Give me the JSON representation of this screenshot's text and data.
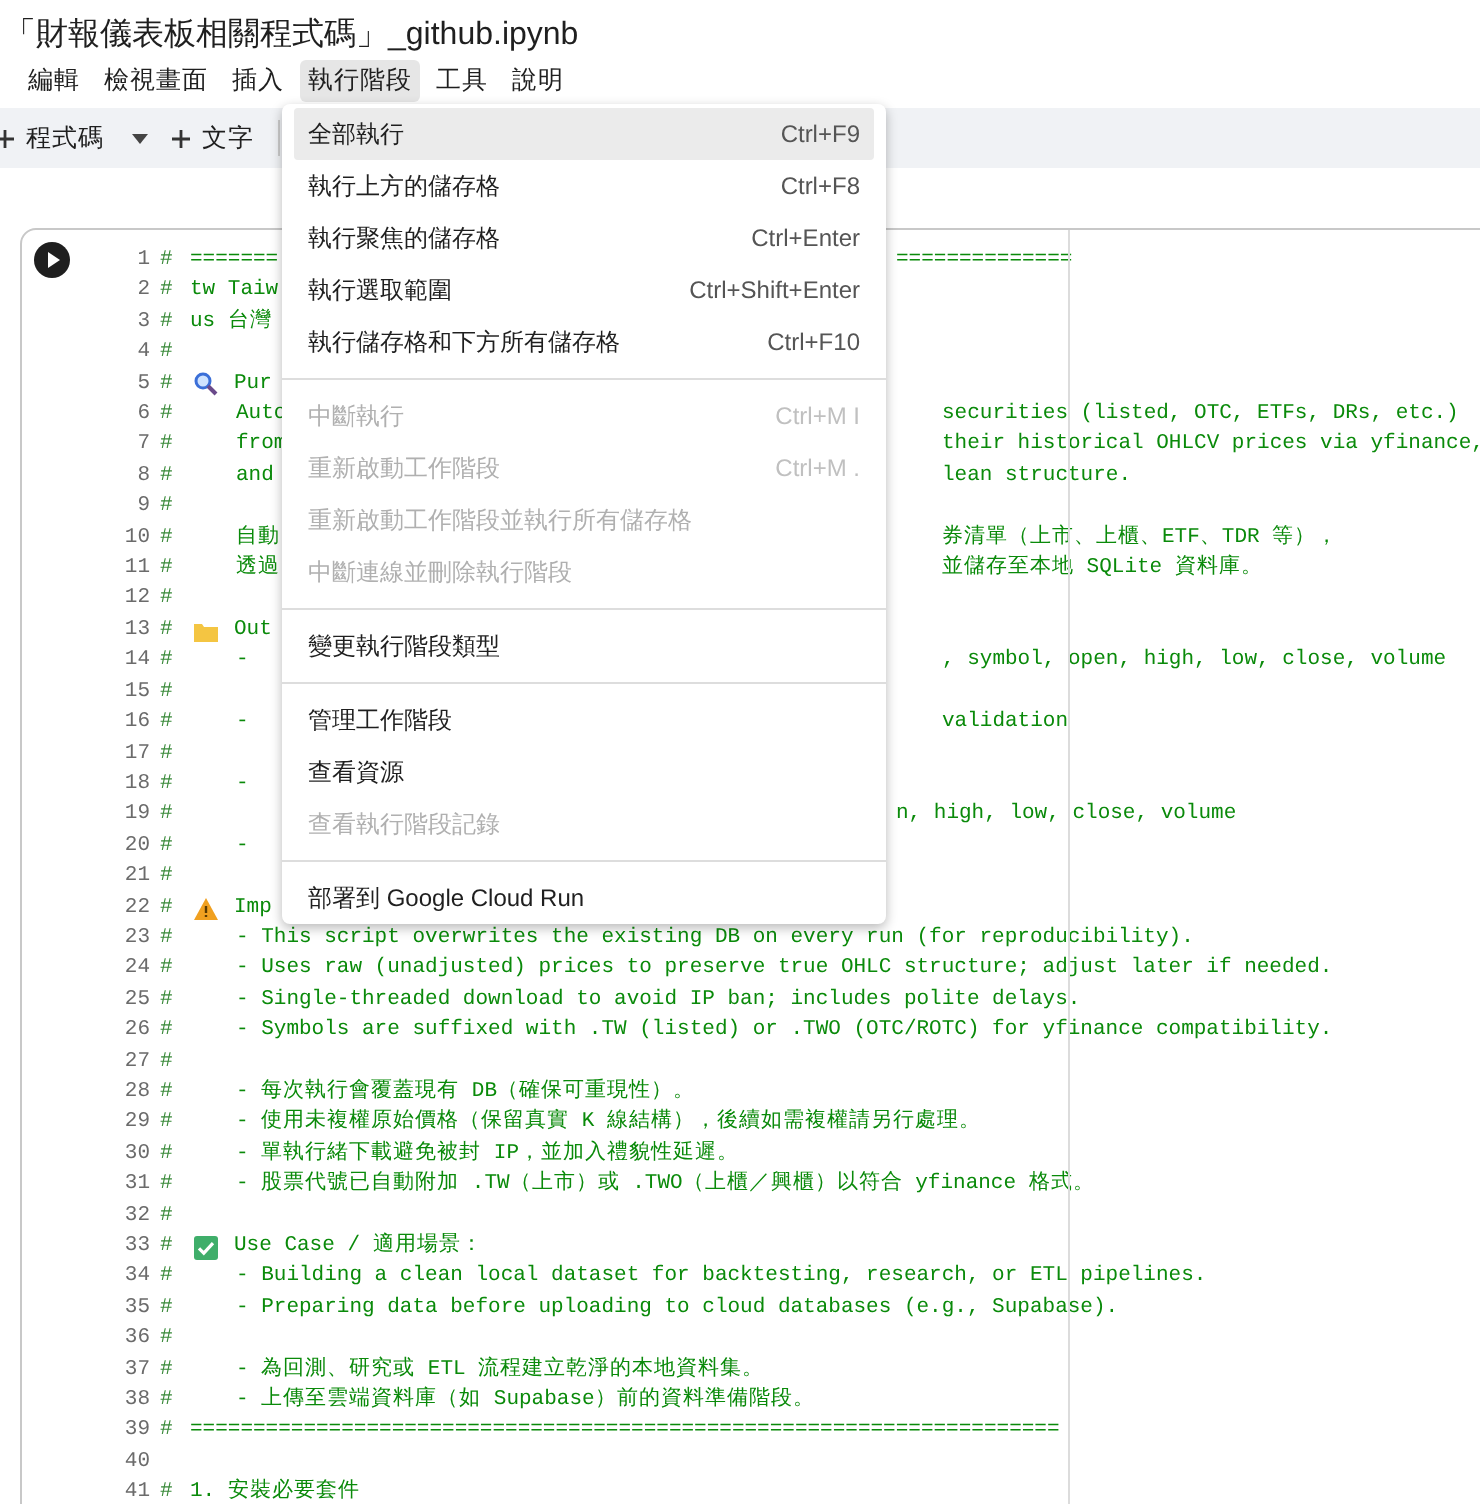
{
  "notebook": {
    "title": "「財報儀表板相關程式碼」_github.ipynb"
  },
  "menubar": [
    {
      "label": "編輯",
      "selected": false
    },
    {
      "label": "檢視畫面",
      "selected": false
    },
    {
      "label": "插入",
      "selected": false
    },
    {
      "label": "執行階段",
      "selected": true
    },
    {
      "label": "工具",
      "selected": false
    },
    {
      "label": "說明",
      "selected": false
    }
  ],
  "toolbar": {
    "code_button": "程式碼",
    "text_button": "文字"
  },
  "runtime_menu": [
    [
      {
        "label": "全部執行",
        "shortcut": "Ctrl+F9",
        "disabled": false,
        "selected": true
      },
      {
        "label": "執行上方的儲存格",
        "shortcut": "Ctrl+F8",
        "disabled": false,
        "selected": false
      },
      {
        "label": "執行聚焦的儲存格",
        "shortcut": "Ctrl+Enter",
        "disabled": false,
        "selected": false
      },
      {
        "label": "執行選取範圍",
        "shortcut": "Ctrl+Shift+Enter",
        "disabled": false,
        "selected": false
      },
      {
        "label": "執行儲存格和下方所有儲存格",
        "shortcut": "Ctrl+F10",
        "disabled": false,
        "selected": false
      }
    ],
    [
      {
        "label": "中斷執行",
        "shortcut": "Ctrl+M I",
        "disabled": true,
        "selected": false
      },
      {
        "label": "重新啟動工作階段",
        "shortcut": "Ctrl+M .",
        "disabled": true,
        "selected": false
      },
      {
        "label": "重新啟動工作階段並執行所有儲存格",
        "disabled": true,
        "selected": false
      },
      {
        "label": "中斷連線並刪除執行階段",
        "disabled": true,
        "selected": false
      }
    ],
    [
      {
        "label": "變更執行階段類型",
        "disabled": false,
        "selected": false
      }
    ],
    [
      {
        "label": "管理工作階段",
        "disabled": false,
        "selected": false
      },
      {
        "label": "查看資源",
        "disabled": false,
        "selected": false
      },
      {
        "label": "查看執行階段記錄",
        "disabled": true,
        "selected": false
      }
    ],
    [
      {
        "label": "部署到 Google Cloud Run",
        "disabled": false,
        "selected": false
      }
    ]
  ],
  "code_lines": [
    {
      "n": "1",
      "hash": "#",
      "indented": false,
      "text": "=======",
      "right": "=============="
    },
    {
      "n": "2",
      "hash": "#",
      "indented": false,
      "text": "tw Taiw"
    },
    {
      "n": "3",
      "hash": "#",
      "indented": false,
      "text": "us 台灣"
    },
    {
      "n": "4",
      "hash": "#"
    },
    {
      "n": "5",
      "hash": "#",
      "indented": false,
      "kind": "search",
      "text": "Pur"
    },
    {
      "n": "6",
      "hash": "#",
      "indented": true,
      "text": "Auto",
      "right": "securities (listed, OTC, ETFs, DRs, etc.)"
    },
    {
      "n": "7",
      "hash": "#",
      "indented": true,
      "text": "from",
      "right": "their historical OHLCV prices via yfinance,"
    },
    {
      "n": "8",
      "hash": "#",
      "indented": true,
      "text": "and",
      "right": "lean structure."
    },
    {
      "n": "9",
      "hash": "#"
    },
    {
      "n": "10",
      "hash": "#",
      "indented": true,
      "text": "自動",
      "right": "券清單（上市、上櫃、ETF、TDR 等），"
    },
    {
      "n": "11",
      "hash": "#",
      "indented": true,
      "text": "透過",
      "right": "並儲存至本地 SQLite 資料庫。"
    },
    {
      "n": "12",
      "hash": "#"
    },
    {
      "n": "13",
      "hash": "#",
      "indented": false,
      "kind": "folder",
      "text": "Out"
    },
    {
      "n": "14",
      "hash": "#",
      "indented": true,
      "text": "-",
      "right": ", symbol, open, high, low, close, volume"
    },
    {
      "n": "15",
      "hash": "#"
    },
    {
      "n": "16",
      "hash": "#",
      "indented": true,
      "text": "-",
      "right": "validation"
    },
    {
      "n": "17",
      "hash": "#"
    },
    {
      "n": "18",
      "hash": "#",
      "indented": true,
      "text": "-"
    },
    {
      "n": "19",
      "hash": "#",
      "right": "n, high, low, close, volume"
    },
    {
      "n": "20",
      "hash": "#",
      "indented": true,
      "text": "-"
    },
    {
      "n": "21",
      "hash": "#"
    },
    {
      "n": "22",
      "hash": "#",
      "indented": false,
      "kind": "warning",
      "text": "Imp"
    },
    {
      "n": "23",
      "hash": "#",
      "indented": true,
      "text": "- This script overwrites the existing DB on every run (for reproducibility)."
    },
    {
      "n": "24",
      "hash": "#",
      "indented": true,
      "text": "- Uses raw (unadjusted) prices to preserve true OHLC structure; adjust later if needed."
    },
    {
      "n": "25",
      "hash": "#",
      "indented": true,
      "text": "- Single-threaded download to avoid IP ban; includes polite delays."
    },
    {
      "n": "26",
      "hash": "#",
      "indented": true,
      "text": "- Symbols are suffixed with .TW (listed) or .TWO (OTC/ROTC) for yfinance compatibility."
    },
    {
      "n": "27",
      "hash": "#"
    },
    {
      "n": "28",
      "hash": "#",
      "indented": true,
      "text": "- 每次執行會覆蓋現有 DB（確保可重現性）。"
    },
    {
      "n": "29",
      "hash": "#",
      "indented": true,
      "text": "- 使用未複權原始價格（保留真實 K 線結構），後續如需複權請另行處理。"
    },
    {
      "n": "30",
      "hash": "#",
      "indented": true,
      "text": "- 單執行緒下載避免被封 IP，並加入禮貌性延遲。"
    },
    {
      "n": "31",
      "hash": "#",
      "indented": true,
      "text": "- 股票代號已自動附加 .TW（上市）或 .TWO（上櫃／興櫃）以符合 yfinance 格式。"
    },
    {
      "n": "32",
      "hash": "#"
    },
    {
      "n": "33",
      "hash": "#",
      "indented": false,
      "kind": "check",
      "text": "Use Case / 適用場景："
    },
    {
      "n": "34",
      "hash": "#",
      "indented": true,
      "text": "- Building a clean local dataset for backtesting, research, or ETL pipelines."
    },
    {
      "n": "35",
      "hash": "#",
      "indented": true,
      "text": "- Preparing data before uploading to cloud databases (e.g., Supabase)."
    },
    {
      "n": "36",
      "hash": "#"
    },
    {
      "n": "37",
      "hash": "#",
      "indented": true,
      "text": "- 為回測、研究或 ETL 流程建立乾淨的本地資料集。"
    },
    {
      "n": "38",
      "hash": "#",
      "indented": true,
      "text": "- 上傳至雲端資料庫（如 Supabase）前的資料準備階段。"
    },
    {
      "n": "39",
      "hash": "#",
      "indented": false,
      "text": "====================================================================="
    },
    {
      "n": "40"
    },
    {
      "n": "41",
      "hash": "#",
      "indented": false,
      "text": "1. 安裝必要套件"
    }
  ]
}
